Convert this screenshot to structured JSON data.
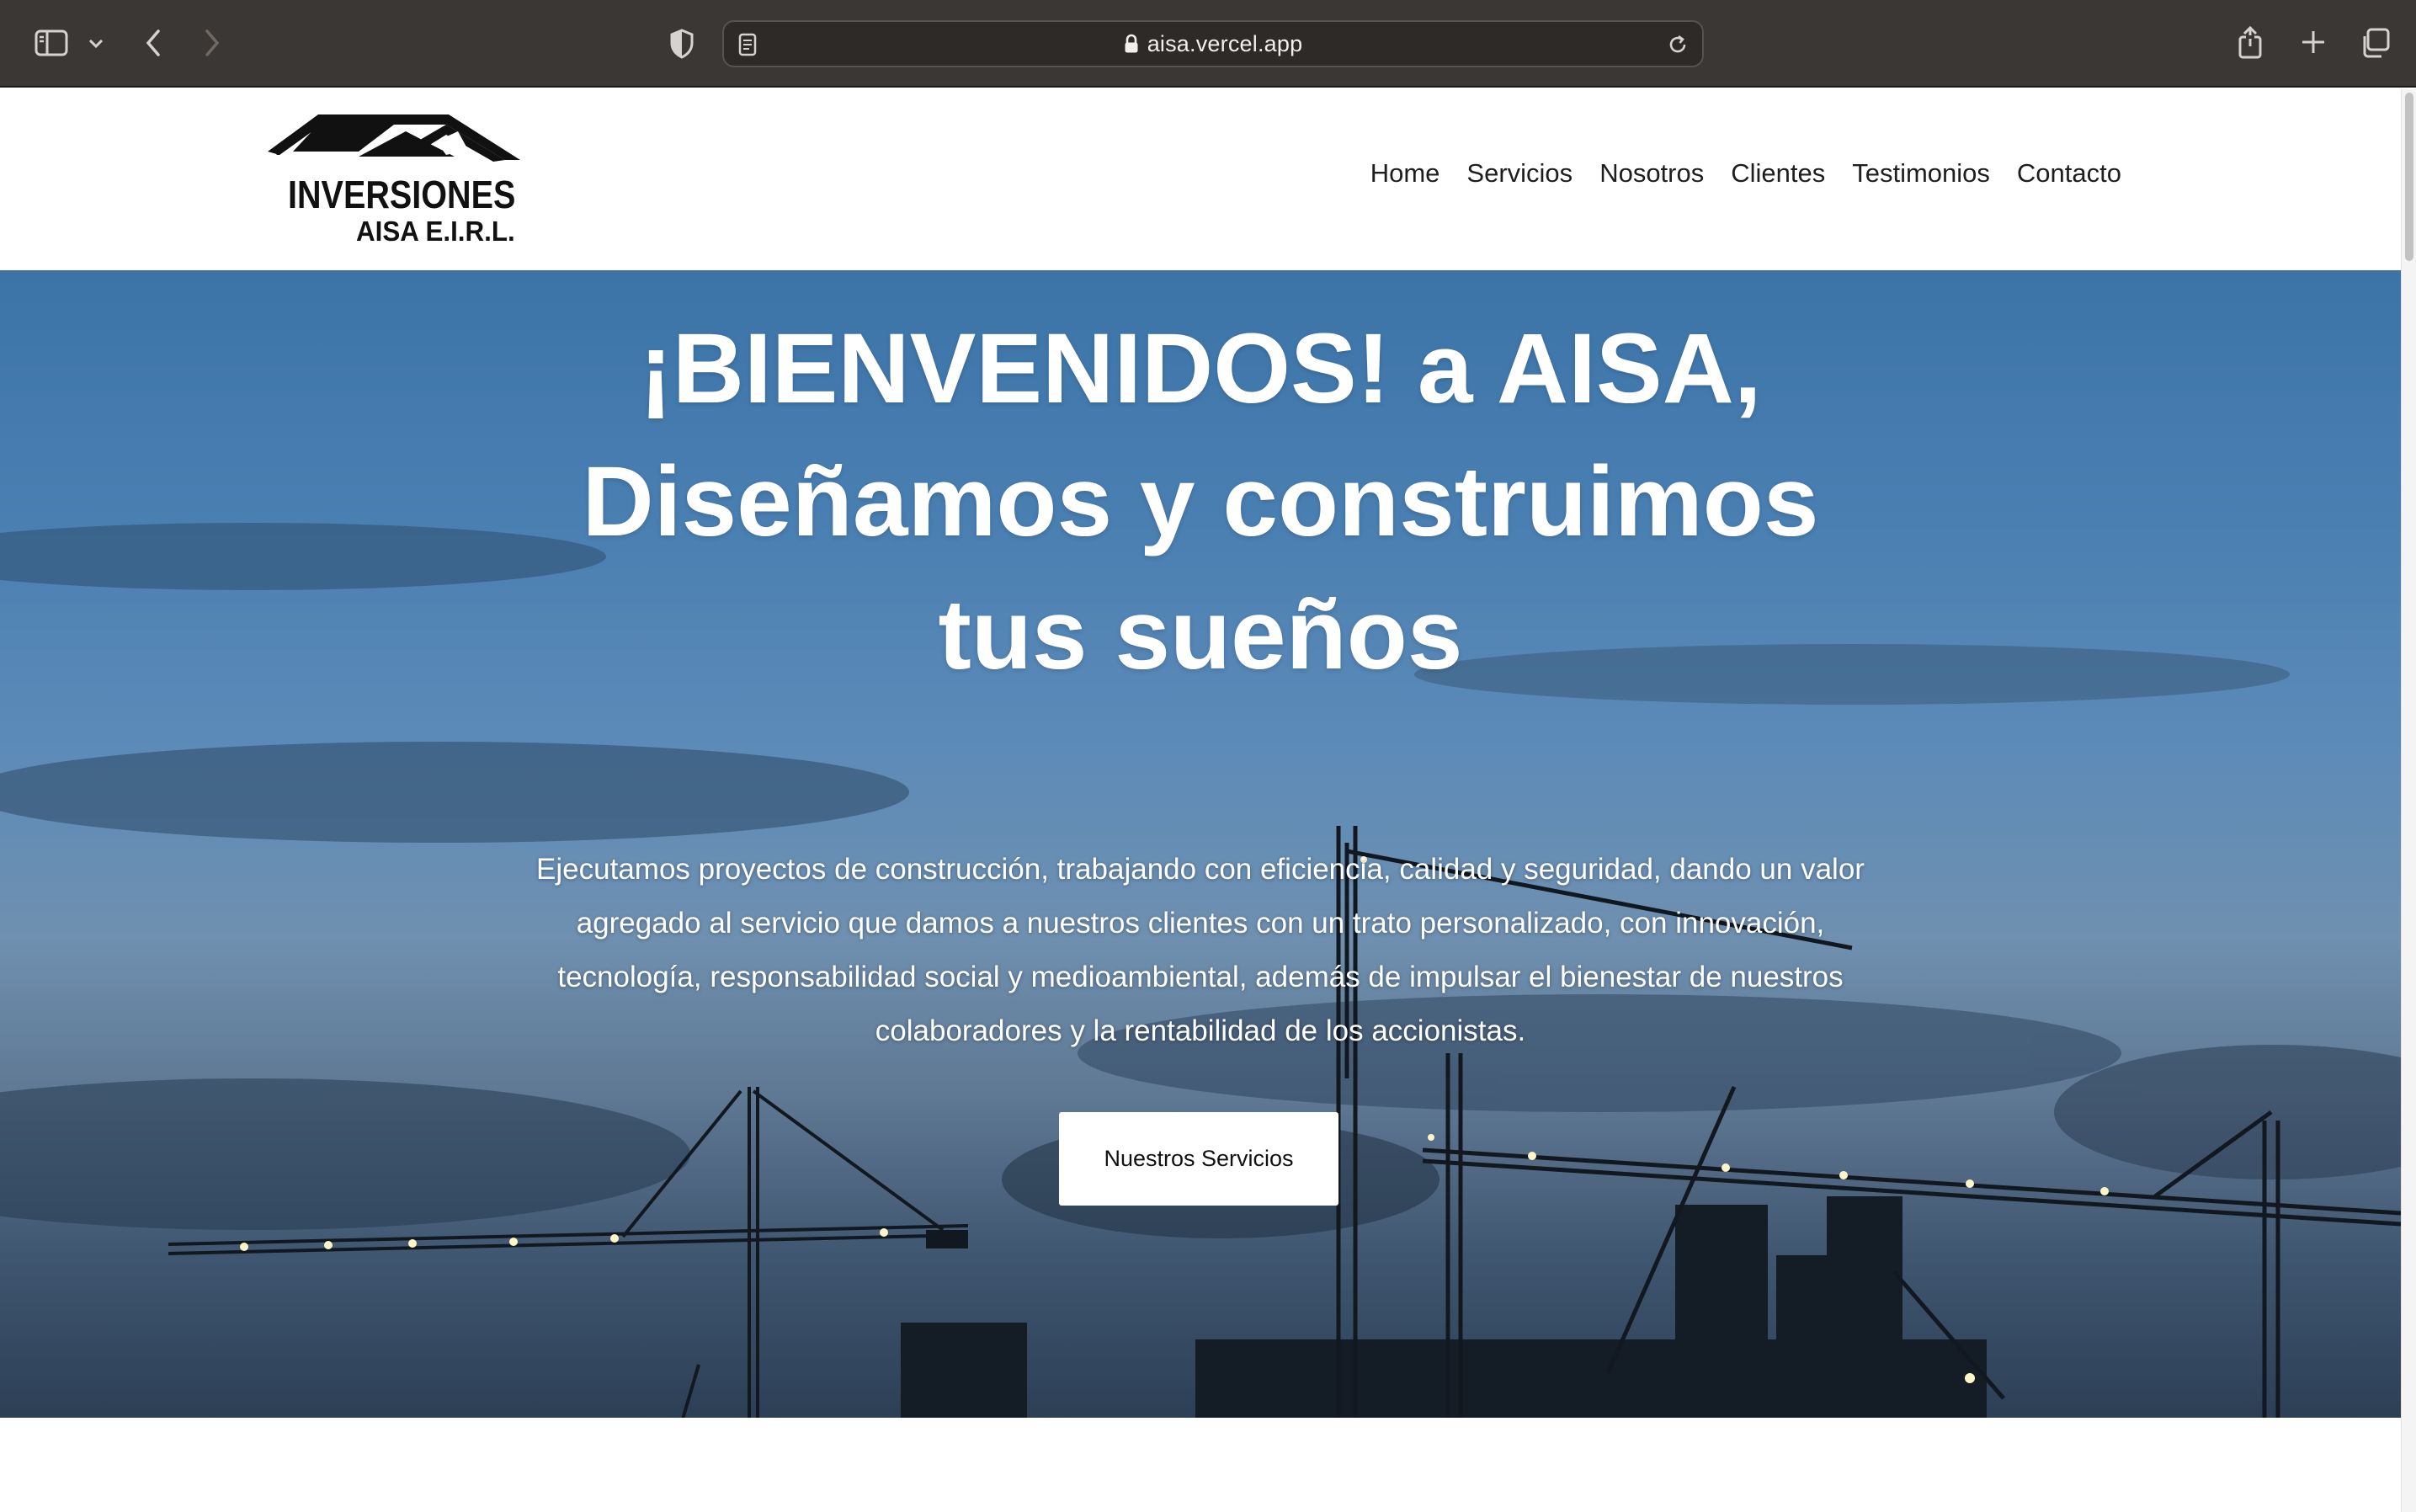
{
  "browser": {
    "url": "aisa.vercel.app",
    "icons": [
      "sidebar-icon",
      "chevron-down-icon",
      "back-icon",
      "forward-icon",
      "shield-icon",
      "reader-icon",
      "lock-icon",
      "reload-icon",
      "share-icon",
      "new-tab-icon",
      "tabs-overview-icon"
    ]
  },
  "header": {
    "logo_line1": "INVERSIONES",
    "logo_line2": "AISA E.I.R.L.",
    "nav": [
      {
        "label": "Home"
      },
      {
        "label": "Servicios"
      },
      {
        "label": "Nosotros"
      },
      {
        "label": "Clientes"
      },
      {
        "label": "Testimonios"
      },
      {
        "label": "Contacto"
      }
    ]
  },
  "hero": {
    "title_line1": "¡BIENVENIDOS! a AISA,",
    "title_line2": "Diseñamos y construimos",
    "title_line3": "tus sueños",
    "text": "Ejecutamos proyectos de construcción, trabajando con eficiencia, calidad y seguridad, dando un valor agregado al servicio que damos a nuestros clientes con un trato personalizado, con innovación, tecnología, responsabilidad social y medioambiental, además de impulsar el bienestar de nuestros colaboradores y la rentabilidad de los accionistas.",
    "cta_label": "Nuestros Servicios"
  },
  "colors": {
    "chrome_bg": "#3b3734",
    "hero_sky": "#4a7fb2",
    "text_dark": "#1e1e1e",
    "white": "#ffffff"
  }
}
